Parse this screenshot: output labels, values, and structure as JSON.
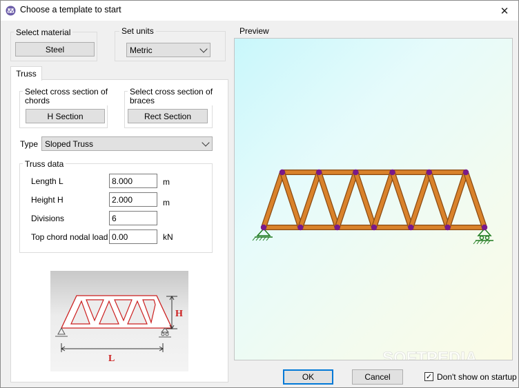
{
  "window": {
    "title": "Choose a template to start",
    "close_glyph": "✕"
  },
  "material": {
    "group_label": "Select material",
    "button_label": "Steel"
  },
  "units": {
    "group_label": "Set units",
    "selected": "Metric"
  },
  "tabs": [
    {
      "label": "Truss"
    }
  ],
  "chords": {
    "group_label_line1": "Select cross section of",
    "group_label_line2": "chords",
    "button_label": "H Section"
  },
  "braces": {
    "group_label_line1": "Select cross section of",
    "group_label_line2": "braces",
    "button_label": "Rect Section"
  },
  "type": {
    "label": "Type",
    "selected": "Sloped Truss"
  },
  "truss_data": {
    "group_label": "Truss data",
    "fields": [
      {
        "label": "Length L",
        "value": "8.000",
        "unit": "m"
      },
      {
        "label": "Height H",
        "value": "2.000",
        "unit": "m"
      },
      {
        "label": "Divisions",
        "value": "6",
        "unit": ""
      },
      {
        "label": "Top chord nodal load",
        "value": "0.00",
        "unit": "kN"
      }
    ]
  },
  "diagram": {
    "height_label": "H",
    "length_label": "L",
    "accent_color": "#cc1f1f"
  },
  "preview": {
    "group_label": "Preview",
    "member_color": "#d9822b",
    "node_color": "#7a1a8a",
    "support_color": "#1f7a1f",
    "watermark": "SOFTPEDIA"
  },
  "footer": {
    "ok_label": "OK",
    "cancel_label": "Cancel",
    "dont_show_label": "Don't show on startup",
    "dont_show_checked": true,
    "check_glyph": "✓"
  }
}
